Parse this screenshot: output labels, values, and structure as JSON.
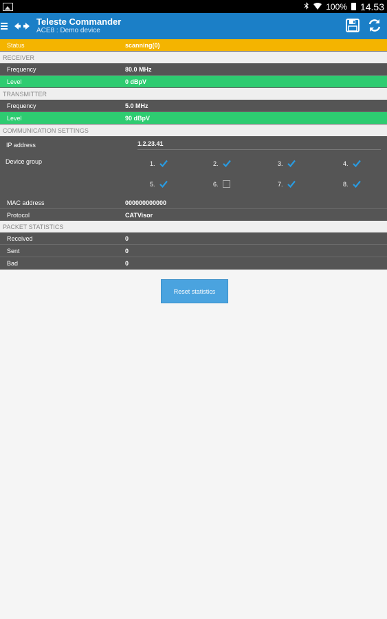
{
  "statusbar": {
    "battery": "100%",
    "time": "14.53"
  },
  "appbar": {
    "title": "Teleste Commander",
    "subtitle": "ACE8 : Demo device"
  },
  "status": {
    "label": "Status",
    "value": "scanning(0)"
  },
  "receiver": {
    "header": "RECEIVER",
    "frequency_label": "Frequency",
    "frequency_value": "80.0 MHz",
    "level_label": "Level",
    "level_value": "0 dBpV"
  },
  "transmitter": {
    "header": "TRANSMITTER",
    "frequency_label": "Frequency",
    "frequency_value": "5.0 MHz",
    "level_label": "Level",
    "level_value": "90 dBpV"
  },
  "comm": {
    "header": "COMMUNICATION SETTINGS",
    "ip_label": "IP address",
    "ip_value": "1.2.23.41",
    "device_group_label": "Device group",
    "groups": [
      {
        "label": "1.",
        "checked": true
      },
      {
        "label": "2.",
        "checked": true
      },
      {
        "label": "3.",
        "checked": true
      },
      {
        "label": "4.",
        "checked": true
      },
      {
        "label": "5.",
        "checked": true
      },
      {
        "label": "6.",
        "checked": false
      },
      {
        "label": "7.",
        "checked": true
      },
      {
        "label": "8.",
        "checked": true
      }
    ],
    "mac_label": "MAC address",
    "mac_value": "000000000000",
    "protocol_label": "Protocol",
    "protocol_value": "CATVisor"
  },
  "packets": {
    "header": "PACKET STATISTICS",
    "received_label": "Received",
    "received_value": "0",
    "sent_label": "Sent",
    "sent_value": "0",
    "bad_label": "Bad",
    "bad_value": "0"
  },
  "reset_button": "Reset statistics",
  "colors": {
    "appbar": "#1b7fc7",
    "status": "#f4b400",
    "level": "#2ecc71",
    "check": "#2a9be0"
  }
}
